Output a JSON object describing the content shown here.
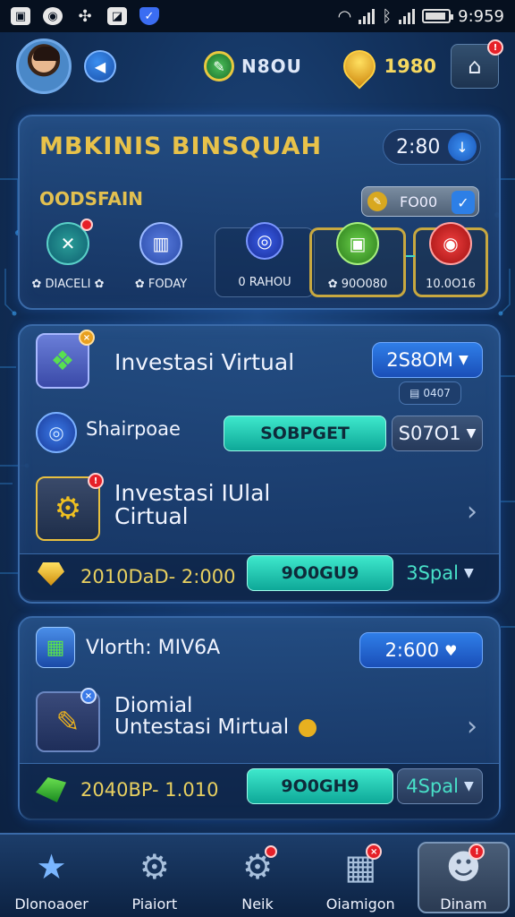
{
  "status_bar": {
    "left_icons": [
      "image-icon",
      "messenger-icon",
      "game-icon",
      "photos-icon",
      "shield-icon"
    ],
    "time": "9:959"
  },
  "header": {
    "brand": "N8OU",
    "coins": "1980"
  },
  "panel": {
    "title": "MBKINIS BINSQUAH",
    "counter": "2:80",
    "subtitle": "OODSFAIN",
    "toggle_label": "FO00",
    "modes": [
      {
        "label": "DIACELI"
      },
      {
        "label": "FODAY"
      },
      {
        "label": "RAHOU"
      },
      {
        "label": "90O080"
      },
      {
        "label": "10.0O16"
      }
    ]
  },
  "card_a": {
    "title": "Investasi Virtual",
    "amount_button": "2S8OM",
    "sub_chip": "0407",
    "row2_label": "Shairpoae",
    "primary_button": "SOBPGET",
    "secondary_button": "S07O1",
    "row3_title_1": "Investasi ΙUlal",
    "row3_title_2": "Cirtual",
    "footer_text": "2010DaD- 2:000",
    "footer_button": "9O0GU9",
    "footer_select": "3Spal"
  },
  "card_b": {
    "title": "Vlorth: MIV6A",
    "amount_button": "2:600",
    "row2_title_1": "Diomial",
    "row2_title_2": "Untestasi Mirtual",
    "footer_text": "2040BP- 1.010",
    "footer_button": "9O0GH9",
    "footer_select": "4Spal"
  },
  "nav": [
    {
      "label": "Dlonoaoer"
    },
    {
      "label": "Piaiort"
    },
    {
      "label": "Neik"
    },
    {
      "label": "Oiamigon"
    },
    {
      "label": "Dinam"
    }
  ],
  "colors": {
    "accent_gold": "#e8c24a",
    "accent_teal": "#3ee8cc",
    "accent_blue": "#2f7ee8",
    "badge_red": "#e62028"
  }
}
